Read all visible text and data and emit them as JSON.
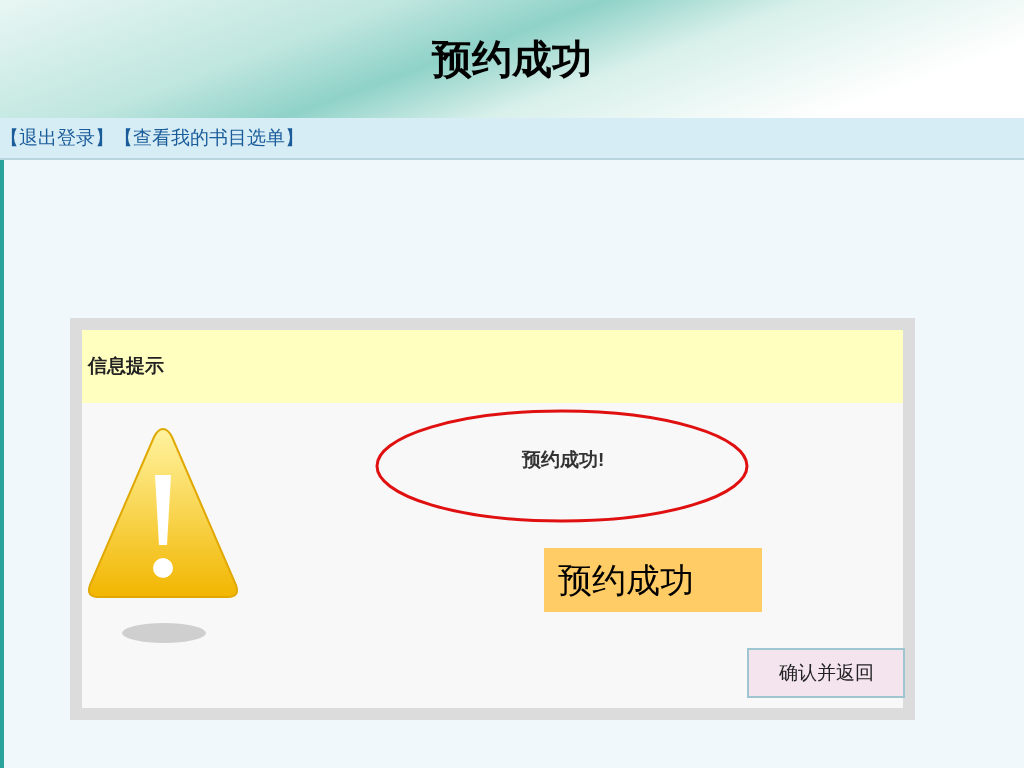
{
  "slide_title": "预约成功",
  "nav_links": [
    "【退出登录】",
    "【查看我的书目选单】"
  ],
  "dialog": {
    "title": "信息提示",
    "message": "预约成功!",
    "button": "确认并返回"
  },
  "callout": "预约成功"
}
